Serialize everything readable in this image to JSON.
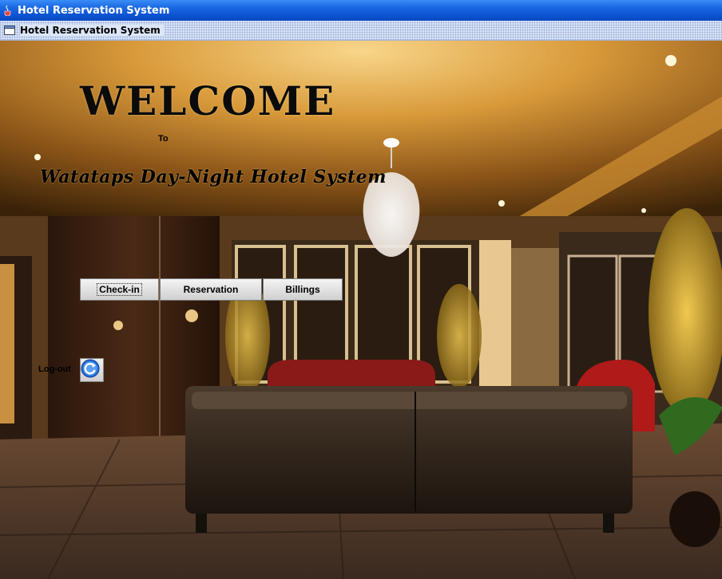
{
  "window": {
    "title": "Hotel Reservation System"
  },
  "internal_frame": {
    "title": "Hotel Reservation System"
  },
  "welcome": {
    "heading": "WELCOME",
    "to": "To",
    "hotel_name": "Watataps Day-Night Hotel System"
  },
  "nav": {
    "checkin_label": "Check-in",
    "reservation_label": "Reservation",
    "billings_label": "Billings"
  },
  "logout": {
    "label": "Log-out",
    "icon": "refresh-logout-icon"
  },
  "colors": {
    "titlebar": "#0d55d4",
    "ceiling_glow": "#e9b24a",
    "floor": "#5a4030"
  }
}
